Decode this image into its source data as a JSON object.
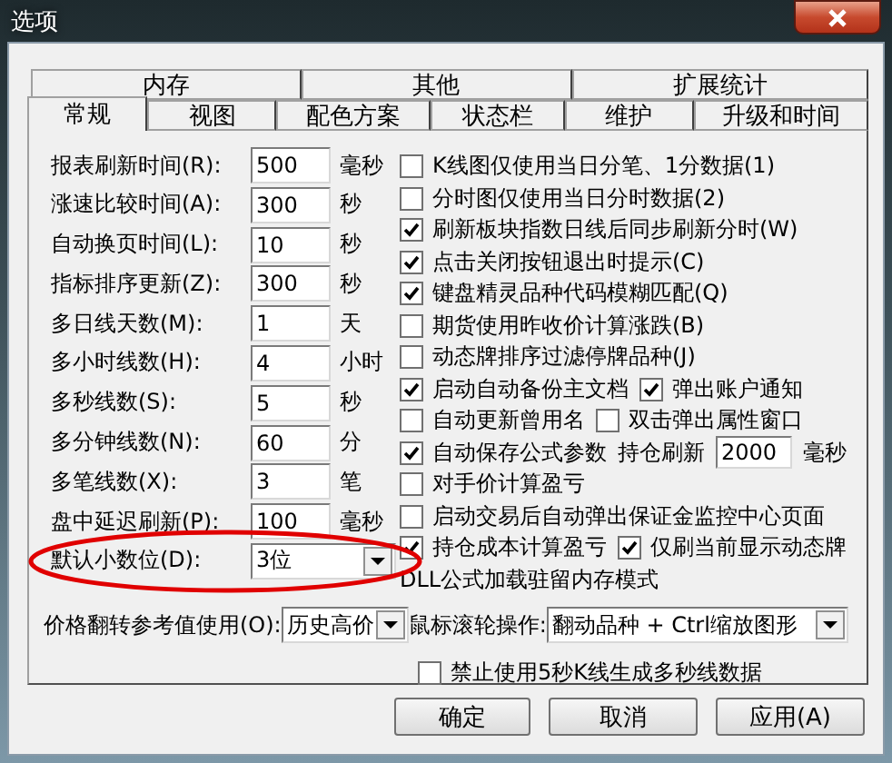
{
  "window": {
    "title": "选项"
  },
  "tab_rows": [
    [
      {
        "label": "内存",
        "selected": false
      },
      {
        "label": "其他",
        "selected": false
      },
      {
        "label": "扩展统计",
        "selected": false
      }
    ],
    [
      {
        "label": "常规",
        "selected": true
      },
      {
        "label": "视图",
        "selected": false
      },
      {
        "label": "配色方案",
        "selected": false
      },
      {
        "label": "状态栏",
        "selected": false
      },
      {
        "label": "维护",
        "selected": false
      },
      {
        "label": "升级和时间",
        "selected": false
      }
    ]
  ],
  "fields": [
    {
      "kind": "input",
      "label": "报表刷新时间(R):",
      "value": "500",
      "unit": "毫秒"
    },
    {
      "kind": "input",
      "label": "涨速比较时间(A):",
      "value": "300",
      "unit": "秒"
    },
    {
      "kind": "input",
      "label": "自动换页时间(L):",
      "value": "10",
      "unit": "秒"
    },
    {
      "kind": "input",
      "label": "指标排序更新(Z):",
      "value": "300",
      "unit": "秒"
    },
    {
      "kind": "input",
      "label": "多日线天数(M):",
      "value": "1",
      "unit": "天"
    },
    {
      "kind": "input",
      "label": "多小时线数(H):",
      "value": "4",
      "unit": "小时"
    },
    {
      "kind": "input",
      "label": "多秒线数(S):",
      "value": "5",
      "unit": "秒"
    },
    {
      "kind": "input",
      "label": "多分钟线数(N):",
      "value": "60",
      "unit": "分"
    },
    {
      "kind": "input",
      "label": "多笔线数(X):",
      "value": "3",
      "unit": "笔"
    },
    {
      "kind": "input",
      "label": "盘中延迟刷新(P):",
      "value": "100",
      "unit": "毫秒"
    },
    {
      "kind": "select",
      "label": "默认小数位(D):",
      "value": "3位",
      "annotated": true
    }
  ],
  "option_rows": [
    {
      "items": [
        {
          "kind": "checkbox",
          "label": "K线图仅使用当日分笔、1分数据(1)",
          "checked": false
        }
      ]
    },
    {
      "items": [
        {
          "kind": "checkbox",
          "label": "分时图仅使用当日分时数据(2)",
          "checked": false
        }
      ]
    },
    {
      "items": [
        {
          "kind": "checkbox",
          "label": "刷新板块指数日线后同步刷新分时(W)",
          "checked": true
        }
      ]
    },
    {
      "items": [
        {
          "kind": "checkbox",
          "label": "点击关闭按钮退出时提示(C)",
          "checked": true
        }
      ]
    },
    {
      "items": [
        {
          "kind": "checkbox",
          "label": "键盘精灵品种代码模糊匹配(Q)",
          "checked": true
        }
      ]
    },
    {
      "items": [
        {
          "kind": "checkbox",
          "label": "期货使用昨收价计算涨跌(B)",
          "checked": false
        }
      ]
    },
    {
      "items": [
        {
          "kind": "checkbox",
          "label": "动态牌排序过滤停牌品种(J)",
          "checked": false
        }
      ]
    },
    {
      "items": [
        {
          "kind": "checkbox",
          "label": "启动自动备份主文档",
          "checked": true
        },
        {
          "kind": "checkbox",
          "label": "弹出账户通知",
          "checked": true
        }
      ]
    },
    {
      "items": [
        {
          "kind": "checkbox",
          "label": "自动更新曾用名",
          "checked": false
        },
        {
          "kind": "checkbox",
          "label": "双击弹出属性窗口",
          "checked": false
        }
      ]
    },
    {
      "items": [
        {
          "kind": "checkbox",
          "label": "自动保存公式参数",
          "checked": true
        }
      ],
      "refresh": {
        "label": "持仓刷新",
        "value": "2000",
        "unit": "毫秒"
      }
    },
    {
      "items": [
        {
          "kind": "checkbox",
          "label": "对手价计算盈亏",
          "checked": false
        }
      ]
    },
    {
      "items": [
        {
          "kind": "checkbox",
          "label": "启动交易后自动弹出保证金监控中心页面",
          "checked": false
        }
      ]
    },
    {
      "items": [
        {
          "kind": "checkbox",
          "label": "持仓成本计算盈亏",
          "checked": true
        },
        {
          "kind": "checkbox",
          "label": "仅刷当前显示动态牌",
          "checked": true
        }
      ]
    },
    {
      "items": [
        {
          "kind": "text",
          "label": "DLL公式加载驻留内存模式"
        }
      ]
    }
  ],
  "price_reference": {
    "label": "价格翻转参考值使用(O):",
    "value": "历史高价"
  },
  "wheel": {
    "label": "鼠标滚轮操作:",
    "value": "翻动品种 + Ctrl缩放图形"
  },
  "bottom_option": {
    "label": "禁止使用5秒K线生成多秒线数据",
    "checked": false
  },
  "buttons": [
    "确定",
    "取消",
    "应用(A)"
  ]
}
